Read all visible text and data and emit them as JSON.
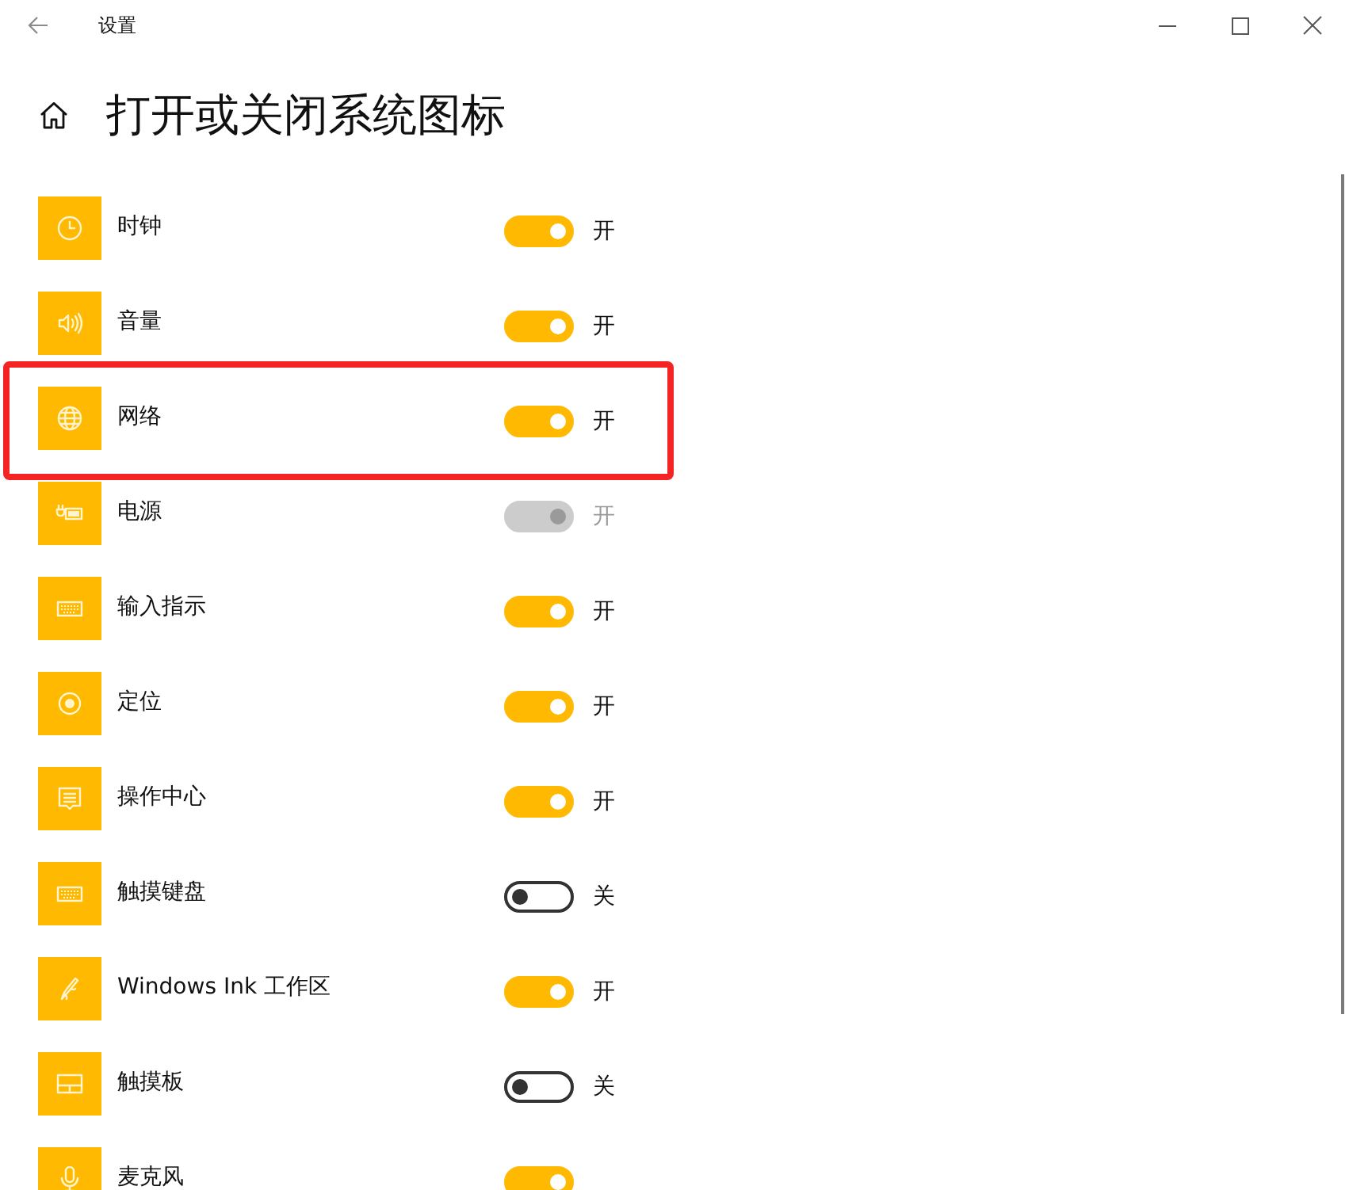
{
  "window": {
    "title": "设置"
  },
  "page": {
    "title": "打开或关闭系统图标"
  },
  "items": [
    {
      "kind": "clock",
      "label": "时钟",
      "on": true,
      "disabled": false,
      "state_label": "开",
      "highlighted": false
    },
    {
      "kind": "volume",
      "label": "音量",
      "on": true,
      "disabled": false,
      "state_label": "开",
      "highlighted": false
    },
    {
      "kind": "network",
      "label": "网络",
      "on": true,
      "disabled": false,
      "state_label": "开",
      "highlighted": true
    },
    {
      "kind": "power",
      "label": "电源",
      "on": true,
      "disabled": true,
      "state_label": "开",
      "highlighted": false
    },
    {
      "kind": "input",
      "label": "输入指示",
      "on": true,
      "disabled": false,
      "state_label": "开",
      "highlighted": false
    },
    {
      "kind": "location",
      "label": "定位",
      "on": true,
      "disabled": false,
      "state_label": "开",
      "highlighted": false
    },
    {
      "kind": "action_center",
      "label": "操作中心",
      "on": true,
      "disabled": false,
      "state_label": "开",
      "highlighted": false
    },
    {
      "kind": "touch_keyboard",
      "label": "触摸键盘",
      "on": false,
      "disabled": false,
      "state_label": "关",
      "highlighted": false
    },
    {
      "kind": "ink",
      "label": "Windows Ink 工作区",
      "on": true,
      "disabled": false,
      "state_label": "开",
      "highlighted": false
    },
    {
      "kind": "touchpad",
      "label": "触摸板",
      "on": false,
      "disabled": false,
      "state_label": "关",
      "highlighted": false
    },
    {
      "kind": "microphone",
      "label": "麦克风",
      "on": true,
      "disabled": false,
      "highlighted": false
    }
  ]
}
